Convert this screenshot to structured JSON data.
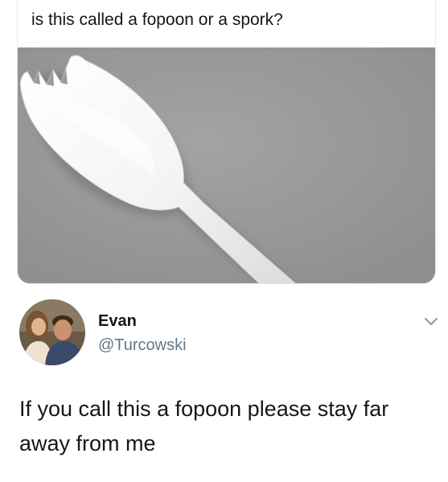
{
  "quoted_card": {
    "caption": "is this called a fopoon or a spork?",
    "image_subject": "white plastic spork on grey background"
  },
  "tweet": {
    "author": {
      "display_name": "Evan",
      "handle": "@Turcowski",
      "avatar_icon": "profile-photo-two-people"
    },
    "menu_icon": "chevron-down-icon",
    "text": "If you call this a fopoon please stay far away from me"
  },
  "colors": {
    "text_primary": "#14171a",
    "text_secondary": "#657786",
    "border": "#e6e9ec",
    "photo_background": "#9a9a9a",
    "spork": "#f7f7f5"
  }
}
